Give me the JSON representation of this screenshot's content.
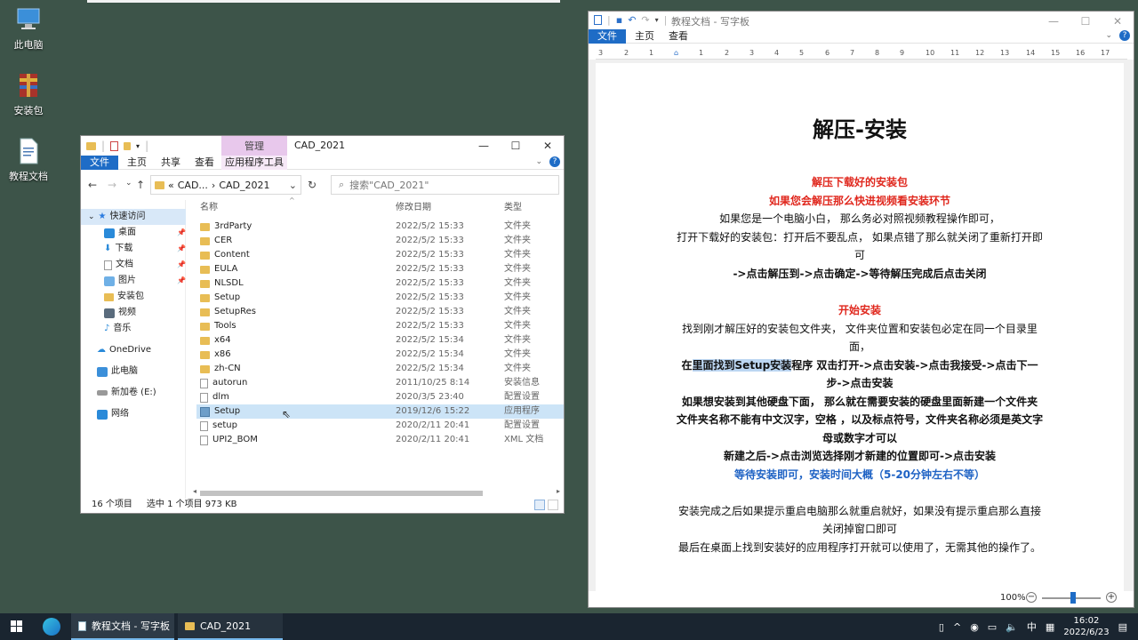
{
  "desktop": {
    "icons": [
      {
        "label": "此电脑"
      },
      {
        "label": "安装包"
      },
      {
        "label": "教程文档"
      }
    ]
  },
  "explorer": {
    "title": "CAD_2021",
    "manage_tab": "管理",
    "ribbon_tabs": [
      "文件",
      "主页",
      "共享",
      "查看",
      "应用程序工具"
    ],
    "address": [
      "«",
      "CAD...",
      "›",
      "CAD_2021"
    ],
    "search_placeholder": "搜索\"CAD_2021\"",
    "columns": {
      "name": "名称",
      "date": "修改日期",
      "type": "类型"
    },
    "nav": [
      {
        "label": "快速访问",
        "pinned": false
      },
      {
        "label": "桌面",
        "pinned": true
      },
      {
        "label": "下载",
        "pinned": true
      },
      {
        "label": "文档",
        "pinned": true
      },
      {
        "label": "图片",
        "pinned": true
      },
      {
        "label": "安装包",
        "pinned": false
      },
      {
        "label": "视频",
        "pinned": false
      },
      {
        "label": "音乐",
        "pinned": false
      },
      {
        "label": "OneDrive",
        "pinned": false
      },
      {
        "label": "此电脑",
        "pinned": false
      },
      {
        "label": "新加卷 (E:)",
        "pinned": false
      },
      {
        "label": "网络",
        "pinned": false
      }
    ],
    "files": [
      {
        "name": "3rdParty",
        "date": "2022/5/2 15:33",
        "type": "文件夹",
        "kind": "folder"
      },
      {
        "name": "CER",
        "date": "2022/5/2 15:33",
        "type": "文件夹",
        "kind": "folder"
      },
      {
        "name": "Content",
        "date": "2022/5/2 15:33",
        "type": "文件夹",
        "kind": "folder"
      },
      {
        "name": "EULA",
        "date": "2022/5/2 15:33",
        "type": "文件夹",
        "kind": "folder"
      },
      {
        "name": "NLSDL",
        "date": "2022/5/2 15:33",
        "type": "文件夹",
        "kind": "folder"
      },
      {
        "name": "Setup",
        "date": "2022/5/2 15:33",
        "type": "文件夹",
        "kind": "folder"
      },
      {
        "name": "SetupRes",
        "date": "2022/5/2 15:33",
        "type": "文件夹",
        "kind": "folder"
      },
      {
        "name": "Tools",
        "date": "2022/5/2 15:33",
        "type": "文件夹",
        "kind": "folder"
      },
      {
        "name": "x64",
        "date": "2022/5/2 15:34",
        "type": "文件夹",
        "kind": "folder"
      },
      {
        "name": "x86",
        "date": "2022/5/2 15:34",
        "type": "文件夹",
        "kind": "folder"
      },
      {
        "name": "zh-CN",
        "date": "2022/5/2 15:34",
        "type": "文件夹",
        "kind": "folder"
      },
      {
        "name": "autorun",
        "date": "2011/10/25 8:14",
        "type": "安装信息",
        "kind": "file"
      },
      {
        "name": "dlm",
        "date": "2020/3/5 23:40",
        "type": "配置设置",
        "kind": "file"
      },
      {
        "name": "Setup",
        "date": "2019/12/6 15:22",
        "type": "应用程序",
        "kind": "app",
        "selected": true
      },
      {
        "name": "setup",
        "date": "2020/2/11 20:41",
        "type": "配置设置",
        "kind": "file"
      },
      {
        "name": "UPI2_BOM",
        "date": "2020/2/11 20:41",
        "type": "XML 文档",
        "kind": "file"
      }
    ],
    "status": {
      "count": "16 个项目",
      "selection": "选中 1 个项目  973 KB"
    }
  },
  "wordpad": {
    "title": "教程文档 - 写字板",
    "ribbon_tabs": [
      "文件",
      "主页",
      "查看"
    ],
    "ruler": [
      "3",
      "2",
      "1",
      "1",
      "2",
      "3",
      "4",
      "5",
      "6",
      "7",
      "8",
      "9",
      "10",
      "11",
      "12",
      "13",
      "14",
      "15",
      "16",
      "17"
    ],
    "doc": {
      "heading": "解压-安装",
      "s1_l1": "解压下载好的安装包",
      "s1_l2": "如果您会解压那么快进视频看安装环节",
      "s1_l3": "如果您是一个电脑小白， 那么务必对照视频教程操作即可，",
      "s1_l4": "打开下载好的安装包：打开后不要乱点， 如果点错了那么就关闭了重新打开即",
      "s1_l5": "可",
      "s1_l6": "->点击解压到->点击确定->等待解压完成后点击关闭",
      "s2_l1": "开始安装",
      "s2_l2": "找到刚才解压好的安装包文件夹， 文件夹位置和安装包必定在同一个目录里",
      "s2_l3": "面，",
      "s2_l4a": "在",
      "s2_l4hl": "里面找到Setup安装",
      "s2_l4b": "程序 双击打开->点击安装->点击我接受->点击下一",
      "s2_l5": "步->点击安装",
      "s2_l6": "如果想安装到其他硬盘下面， 那么就在需要安装的硬盘里面新建一个文件夹",
      "s2_l7": "文件夹名称不能有中文汉字，空格 ，以及标点符号，文件夹名称必须是英文字",
      "s2_l8": "母或数字才可以",
      "s2_l9": "新建之后->点击浏览选择刚才新建的位置即可->点击安装",
      "s2_l10": "等待安装即可，安装时间大概（5-20分钟左右不等）",
      "s3_l1": "安装完成之后如果提示重启电脑那么就重启就好，如果没有提示重启那么直接",
      "s3_l2": "关闭掉窗口即可",
      "s3_l3": "最后在桌面上找到安装好的应用程序打开就可以使用了，无需其他的操作了。"
    },
    "zoom": "100%"
  },
  "taskbar": {
    "apps": [
      {
        "label": "教程文档 - 写字板"
      },
      {
        "label": "CAD_2021"
      }
    ],
    "ime": "中",
    "time": "16:02",
    "date": "2022/6/23"
  }
}
